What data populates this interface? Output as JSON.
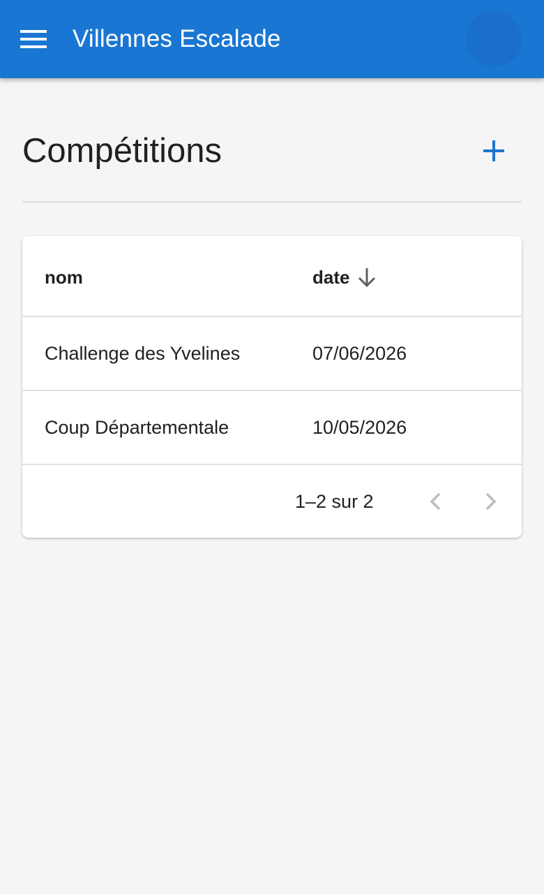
{
  "appbar": {
    "title": "Villennes Escalade",
    "menu_icon": "menu-icon",
    "color": "#1976d2"
  },
  "page": {
    "title": "Compétitions",
    "add_icon": "plus-icon",
    "accent": "#1976d2"
  },
  "table": {
    "columns": [
      {
        "label": "nom"
      },
      {
        "label": "date",
        "sort": "descending",
        "sort_icon": "arrow-down-icon"
      }
    ],
    "rows": [
      {
        "nom": "Challenge des Yvelines",
        "date": "07/06/2026"
      },
      {
        "nom": "Coup Départementale",
        "date": "10/05/2026"
      }
    ],
    "pagination": {
      "label": "1–2 sur 2",
      "prev_icon": "chevron-left-icon",
      "next_icon": "chevron-right-icon",
      "prev_disabled": true,
      "next_disabled": true
    }
  }
}
